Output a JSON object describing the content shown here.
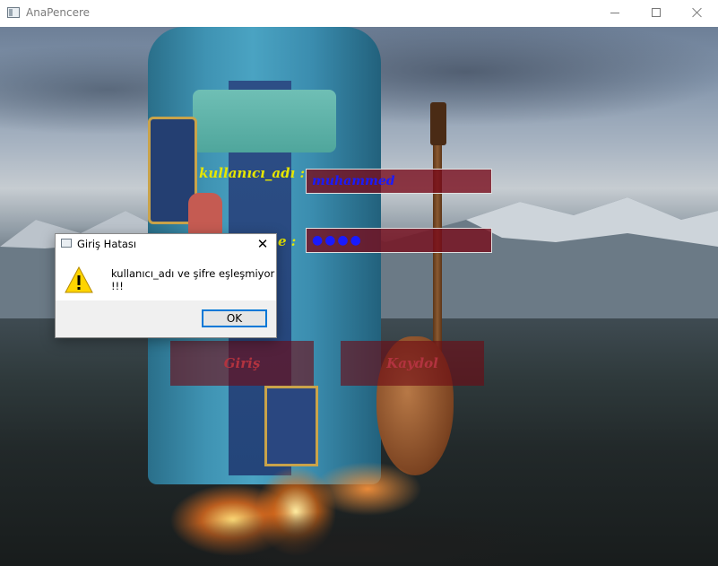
{
  "window": {
    "title": "AnaPencere",
    "minimize_glyph": "—",
    "maximize_glyph": "☐",
    "close_glyph": "✕"
  },
  "form": {
    "username_label": "kullanıcı_adı :",
    "username_value": "muhammed",
    "password_label": "e :",
    "password_value": "●●●●",
    "login_button": "Giriş",
    "register_button": "Kaydol"
  },
  "dialog": {
    "title": "Giriş Hatası",
    "close_glyph": "✕",
    "message": "kullanıcı_adı ve şifre eşleşmiyor !!!",
    "ok_label": "OK",
    "icon": "warning-icon"
  },
  "colors": {
    "label_yellow": "#e6e600",
    "input_text_blue": "#1a1aff",
    "field_bg": "#780a19",
    "button_text": "#b2333f",
    "accent_focus": "#0078d7"
  }
}
